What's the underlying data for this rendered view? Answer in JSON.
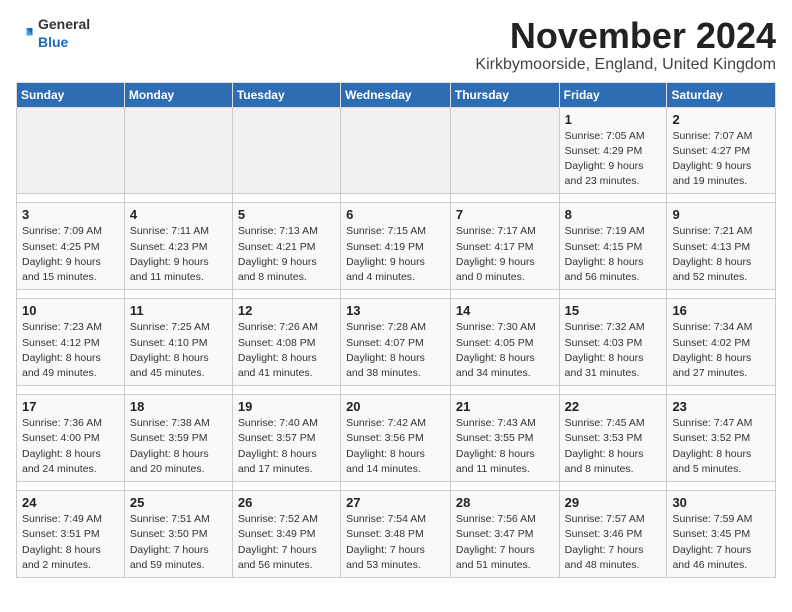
{
  "logo": {
    "general": "General",
    "blue": "Blue"
  },
  "title": "November 2024",
  "subtitle": "Kirkbymoorside, England, United Kingdom",
  "days_of_week": [
    "Sunday",
    "Monday",
    "Tuesday",
    "Wednesday",
    "Thursday",
    "Friday",
    "Saturday"
  ],
  "weeks": [
    {
      "days": [
        {
          "date": "",
          "info": ""
        },
        {
          "date": "",
          "info": ""
        },
        {
          "date": "",
          "info": ""
        },
        {
          "date": "",
          "info": ""
        },
        {
          "date": "",
          "info": ""
        },
        {
          "date": "1",
          "info": "Sunrise: 7:05 AM\nSunset: 4:29 PM\nDaylight: 9 hours\nand 23 minutes."
        },
        {
          "date": "2",
          "info": "Sunrise: 7:07 AM\nSunset: 4:27 PM\nDaylight: 9 hours\nand 19 minutes."
        }
      ]
    },
    {
      "days": [
        {
          "date": "3",
          "info": "Sunrise: 7:09 AM\nSunset: 4:25 PM\nDaylight: 9 hours\nand 15 minutes."
        },
        {
          "date": "4",
          "info": "Sunrise: 7:11 AM\nSunset: 4:23 PM\nDaylight: 9 hours\nand 11 minutes."
        },
        {
          "date": "5",
          "info": "Sunrise: 7:13 AM\nSunset: 4:21 PM\nDaylight: 9 hours\nand 8 minutes."
        },
        {
          "date": "6",
          "info": "Sunrise: 7:15 AM\nSunset: 4:19 PM\nDaylight: 9 hours\nand 4 minutes."
        },
        {
          "date": "7",
          "info": "Sunrise: 7:17 AM\nSunset: 4:17 PM\nDaylight: 9 hours\nand 0 minutes."
        },
        {
          "date": "8",
          "info": "Sunrise: 7:19 AM\nSunset: 4:15 PM\nDaylight: 8 hours\nand 56 minutes."
        },
        {
          "date": "9",
          "info": "Sunrise: 7:21 AM\nSunset: 4:13 PM\nDaylight: 8 hours\nand 52 minutes."
        }
      ]
    },
    {
      "days": [
        {
          "date": "10",
          "info": "Sunrise: 7:23 AM\nSunset: 4:12 PM\nDaylight: 8 hours\nand 49 minutes."
        },
        {
          "date": "11",
          "info": "Sunrise: 7:25 AM\nSunset: 4:10 PM\nDaylight: 8 hours\nand 45 minutes."
        },
        {
          "date": "12",
          "info": "Sunrise: 7:26 AM\nSunset: 4:08 PM\nDaylight: 8 hours\nand 41 minutes."
        },
        {
          "date": "13",
          "info": "Sunrise: 7:28 AM\nSunset: 4:07 PM\nDaylight: 8 hours\nand 38 minutes."
        },
        {
          "date": "14",
          "info": "Sunrise: 7:30 AM\nSunset: 4:05 PM\nDaylight: 8 hours\nand 34 minutes."
        },
        {
          "date": "15",
          "info": "Sunrise: 7:32 AM\nSunset: 4:03 PM\nDaylight: 8 hours\nand 31 minutes."
        },
        {
          "date": "16",
          "info": "Sunrise: 7:34 AM\nSunset: 4:02 PM\nDaylight: 8 hours\nand 27 minutes."
        }
      ]
    },
    {
      "days": [
        {
          "date": "17",
          "info": "Sunrise: 7:36 AM\nSunset: 4:00 PM\nDaylight: 8 hours\nand 24 minutes."
        },
        {
          "date": "18",
          "info": "Sunrise: 7:38 AM\nSunset: 3:59 PM\nDaylight: 8 hours\nand 20 minutes."
        },
        {
          "date": "19",
          "info": "Sunrise: 7:40 AM\nSunset: 3:57 PM\nDaylight: 8 hours\nand 17 minutes."
        },
        {
          "date": "20",
          "info": "Sunrise: 7:42 AM\nSunset: 3:56 PM\nDaylight: 8 hours\nand 14 minutes."
        },
        {
          "date": "21",
          "info": "Sunrise: 7:43 AM\nSunset: 3:55 PM\nDaylight: 8 hours\nand 11 minutes."
        },
        {
          "date": "22",
          "info": "Sunrise: 7:45 AM\nSunset: 3:53 PM\nDaylight: 8 hours\nand 8 minutes."
        },
        {
          "date": "23",
          "info": "Sunrise: 7:47 AM\nSunset: 3:52 PM\nDaylight: 8 hours\nand 5 minutes."
        }
      ]
    },
    {
      "days": [
        {
          "date": "24",
          "info": "Sunrise: 7:49 AM\nSunset: 3:51 PM\nDaylight: 8 hours\nand 2 minutes."
        },
        {
          "date": "25",
          "info": "Sunrise: 7:51 AM\nSunset: 3:50 PM\nDaylight: 7 hours\nand 59 minutes."
        },
        {
          "date": "26",
          "info": "Sunrise: 7:52 AM\nSunset: 3:49 PM\nDaylight: 7 hours\nand 56 minutes."
        },
        {
          "date": "27",
          "info": "Sunrise: 7:54 AM\nSunset: 3:48 PM\nDaylight: 7 hours\nand 53 minutes."
        },
        {
          "date": "28",
          "info": "Sunrise: 7:56 AM\nSunset: 3:47 PM\nDaylight: 7 hours\nand 51 minutes."
        },
        {
          "date": "29",
          "info": "Sunrise: 7:57 AM\nSunset: 3:46 PM\nDaylight: 7 hours\nand 48 minutes."
        },
        {
          "date": "30",
          "info": "Sunrise: 7:59 AM\nSunset: 3:45 PM\nDaylight: 7 hours\nand 46 minutes."
        }
      ]
    }
  ]
}
